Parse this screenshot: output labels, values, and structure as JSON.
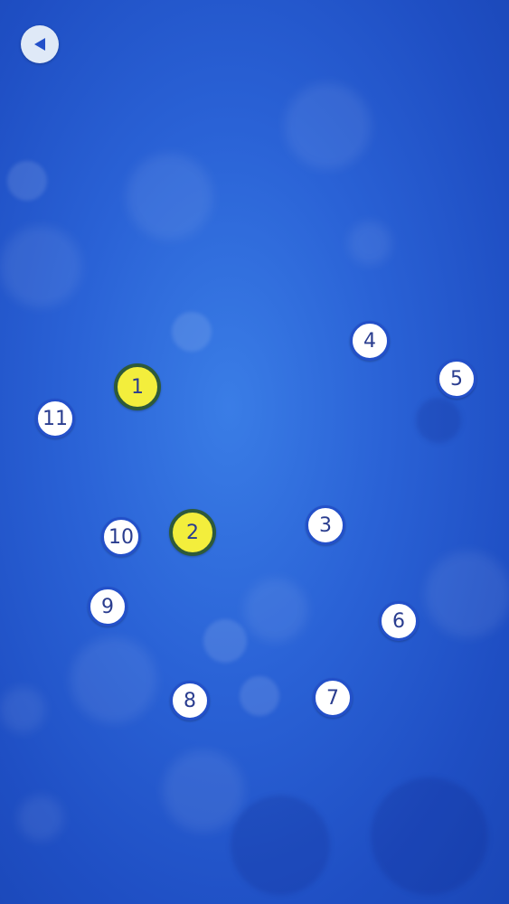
{
  "colors": {
    "background": "#2a62d6",
    "dot_fill": "#ffffff",
    "dot_ring": "#2350c9",
    "dot_text": "#2a3d8f",
    "done_fill": "#f3ee3c",
    "done_ring": "#2e5a3a"
  },
  "back_button": {
    "icon": "triangle-left-icon"
  },
  "dots": [
    {
      "label": "1",
      "state": "connected"
    },
    {
      "label": "2",
      "state": "connected"
    },
    {
      "label": "3",
      "state": "pending"
    },
    {
      "label": "4",
      "state": "pending"
    },
    {
      "label": "5",
      "state": "pending"
    },
    {
      "label": "6",
      "state": "pending"
    },
    {
      "label": "7",
      "state": "pending"
    },
    {
      "label": "8",
      "state": "pending"
    },
    {
      "label": "9",
      "state": "pending"
    },
    {
      "label": "10",
      "state": "pending"
    },
    {
      "label": "11",
      "state": "pending"
    }
  ]
}
